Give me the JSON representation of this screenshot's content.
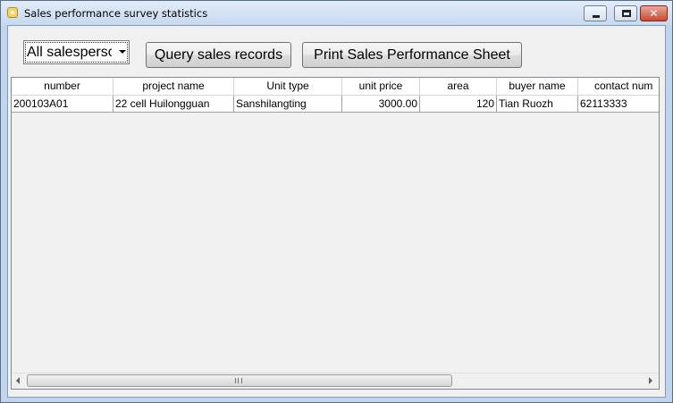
{
  "window": {
    "title": "Sales performance survey statistics"
  },
  "filter": {
    "salesperson_selected": "All salesperson"
  },
  "toolbar": {
    "query_label": "Query sales records",
    "print_label": "Print Sales Performance Sheet"
  },
  "table": {
    "columns": [
      "number",
      "project name",
      "Unit type",
      "unit price",
      "area",
      "buyer name",
      "contact num"
    ],
    "rows": [
      [
        "200103A01",
        "22 cell Huilongguan",
        "Sanshilangting",
        "3000.00",
        "120",
        "Tian Ruozh",
        "62113333"
      ]
    ]
  },
  "scrollbar": {
    "grip_glyph": "III"
  }
}
